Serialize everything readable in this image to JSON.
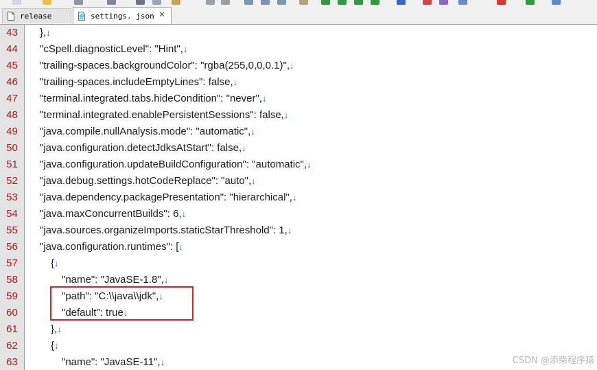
{
  "tabs": [
    {
      "label": "release",
      "active": false,
      "icon": "document-icon"
    },
    {
      "label": "settings. json",
      "active": true,
      "icon": "json-document-icon",
      "close": "✕"
    }
  ],
  "editor": {
    "eol_marker": "↓",
    "lines": [
      {
        "num": "43",
        "indent": 0,
        "text": "},"
      },
      {
        "num": "44",
        "indent": 0,
        "text": "\"cSpell.diagnosticLevel\": \"Hint\","
      },
      {
        "num": "45",
        "indent": 0,
        "text": "\"trailing-spaces.backgroundColor\": \"rgba(255,0,0,0.1)\","
      },
      {
        "num": "46",
        "indent": 0,
        "text": "\"trailing-spaces.includeEmptyLines\": false,"
      },
      {
        "num": "47",
        "indent": 0,
        "text": "\"terminal.integrated.tabs.hideCondition\": \"never\","
      },
      {
        "num": "48",
        "indent": 0,
        "text": "\"terminal.integrated.enablePersistentSessions\": false,"
      },
      {
        "num": "49",
        "indent": 0,
        "text": "\"java.compile.nullAnalysis.mode\": \"automatic\","
      },
      {
        "num": "50",
        "indent": 0,
        "text": "\"java.configuration.detectJdksAtStart\": false,"
      },
      {
        "num": "51",
        "indent": 0,
        "text": "\"java.configuration.updateBuildConfiguration\": \"automatic\","
      },
      {
        "num": "52",
        "indent": 0,
        "text": "\"java.debug.settings.hotCodeReplace\": \"auto\","
      },
      {
        "num": "53",
        "indent": 0,
        "text": "\"java.dependency.packagePresentation\": \"hierarchical\","
      },
      {
        "num": "54",
        "indent": 0,
        "text": "\"java.maxConcurrentBuilds\": 6,"
      },
      {
        "num": "55",
        "indent": 0,
        "text": "\"java.sources.organizeImports.staticStarThreshold\": 1,"
      },
      {
        "num": "56",
        "indent": 0,
        "text": "\"java.configuration.runtimes\": ["
      },
      {
        "num": "57",
        "indent": 1,
        "text": "{"
      },
      {
        "num": "58",
        "indent": 2,
        "text": "\"name\": \"JavaSE-1.8\","
      },
      {
        "num": "59",
        "indent": 2,
        "text": "\"path\": \"C:\\\\java\\\\jdk\","
      },
      {
        "num": "60",
        "indent": 2,
        "text": "\"default\": true"
      },
      {
        "num": "61",
        "indent": 1,
        "text": "},"
      },
      {
        "num": "62",
        "indent": 1,
        "text": "{"
      },
      {
        "num": "63",
        "indent": 2,
        "text": "\"name\": \"JavaSE-11\","
      }
    ]
  },
  "watermark": "CSDN @添柴程序猿",
  "colors": {
    "line_number": "#ab1a1a",
    "eol_marker": "#1e64d2",
    "highlight_box": "#d9232d",
    "gutter": "#e4e4e4"
  }
}
